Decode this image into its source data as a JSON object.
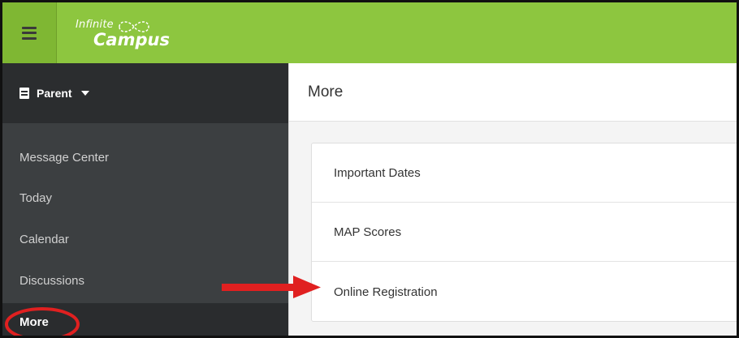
{
  "app": {
    "logo_line1": "Infinite",
    "logo_line2": "Campus",
    "accent_color": "#8dc63f"
  },
  "topbar": {
    "menu_icon": "hamburger-menu-icon"
  },
  "sidebar": {
    "persona_icon": "document-icon",
    "persona_label": "Parent",
    "persona_caret_icon": "caret-down-icon",
    "items": [
      {
        "label": "Message Center"
      },
      {
        "label": "Today"
      },
      {
        "label": "Calendar"
      },
      {
        "label": "Discussions"
      },
      {
        "label": "More",
        "active": true
      }
    ]
  },
  "main": {
    "title": "More",
    "items": [
      {
        "label": "Important Dates"
      },
      {
        "label": "MAP Scores"
      },
      {
        "label": "Online Registration"
      }
    ]
  },
  "annotations": {
    "arrow_color": "#e02020",
    "circle_color": "#e02020"
  }
}
